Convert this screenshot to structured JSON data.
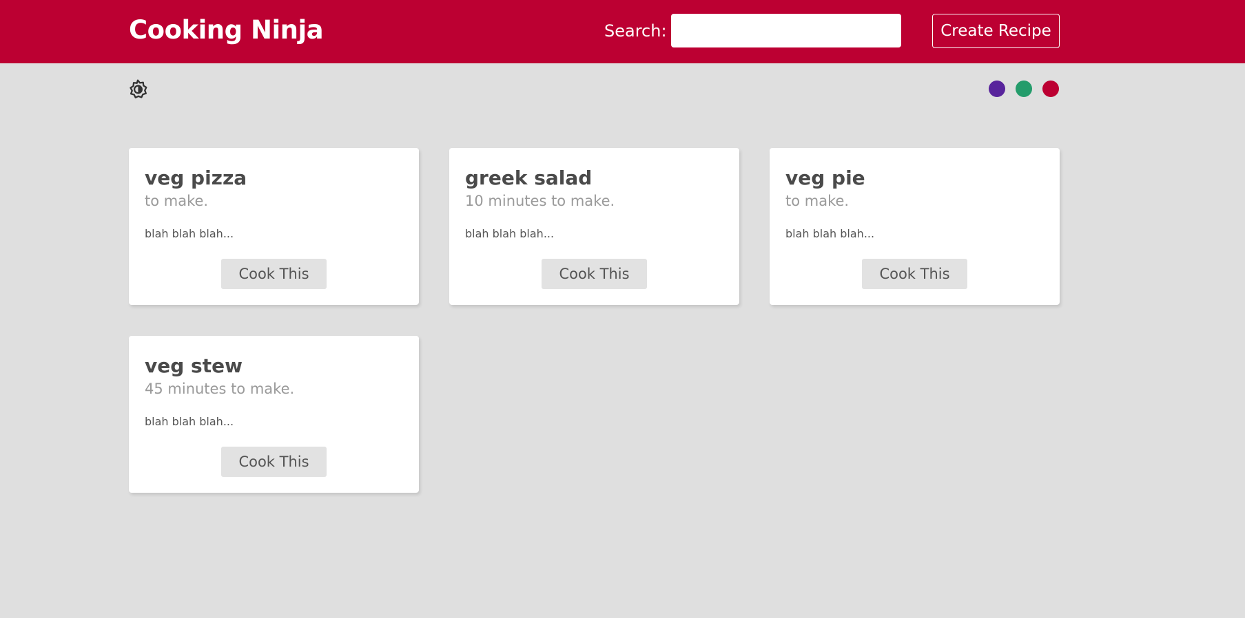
{
  "navbar": {
    "brand": "Cooking Ninja",
    "search_label": "Search:",
    "search_value": "",
    "create_label": "Create Recipe"
  },
  "theme": {
    "mode_icon": "brightness-toggle-icon",
    "swatches": [
      {
        "name": "purple",
        "color": "#58249c"
      },
      {
        "name": "green",
        "color": "#249c6b"
      },
      {
        "name": "red",
        "color": "#bc0032"
      }
    ]
  },
  "recipes": [
    {
      "title": "veg pizza",
      "time": "to make.",
      "desc": "blah blah blah...",
      "button": "Cook This"
    },
    {
      "title": "greek salad",
      "time": "10 minutes to make.",
      "desc": "blah blah blah...",
      "button": "Cook This"
    },
    {
      "title": "veg pie",
      "time": "to make.",
      "desc": "blah blah blah...",
      "button": "Cook This"
    },
    {
      "title": "veg stew",
      "time": "45 minutes to make.",
      "desc": "blah blah blah...",
      "button": "Cook This"
    }
  ]
}
